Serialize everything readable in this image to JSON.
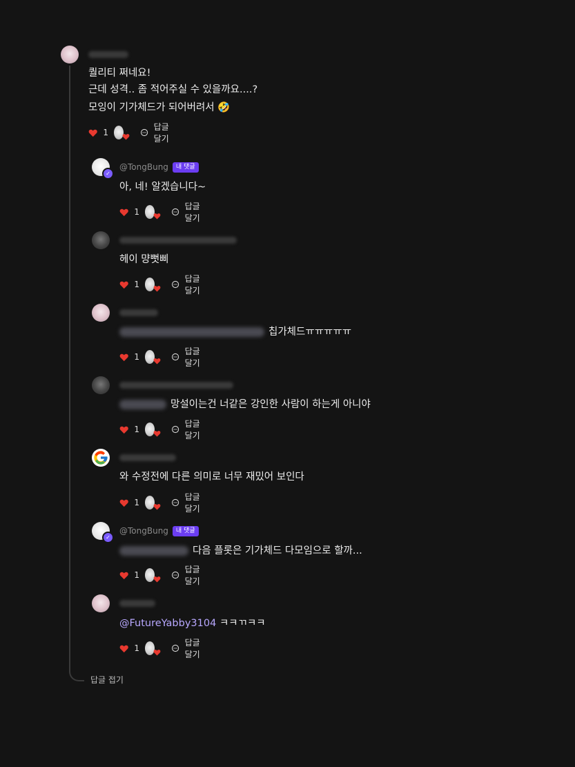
{
  "root": {
    "text_lines": [
      "퀄리티 쩌네요!",
      "근데 성격.. 좀 적어주실 수 있을까요....?",
      "모잉이 기가체드가 되어버려서 🤣"
    ],
    "likes": "1",
    "reply_label": "답글 달기"
  },
  "replies": [
    {
      "username": "@TongBung",
      "badge": "내 댓글",
      "text": "아, 네! 알겠습니다~",
      "likes": "1",
      "reply_label": "답글 달기"
    },
    {
      "text": "헤이 먕뻣삐",
      "likes": "1",
      "reply_label": "답글 달기"
    },
    {
      "text": "칩가체드ㅠㅠㅠㅠㅠ",
      "likes": "1",
      "reply_label": "답글 달기"
    },
    {
      "text": "망설이는건 너같은 강인한 사람이 하는게 아니야",
      "likes": "1",
      "reply_label": "답글 달기"
    },
    {
      "text": "와 수정전에 다른 의미로 너무 재밌어 보인다",
      "likes": "1",
      "reply_label": "답글 달기"
    },
    {
      "username": "@TongBung",
      "badge": "내 댓글",
      "text": "다음 플롯은 기가체드 다모임으로 할까...",
      "likes": "1",
      "reply_label": "답글 달기"
    },
    {
      "mention": "@FutureYabby3104",
      "text": "ㅋㅋㄲㅋㅋ",
      "likes": "1",
      "reply_label": "답글 달기"
    }
  ],
  "collapse_label": "답글 접기",
  "colors": {
    "background": "#141414",
    "heart": "#e8392f",
    "badge": "#6b3df2",
    "mention": "#b8a8ff"
  }
}
